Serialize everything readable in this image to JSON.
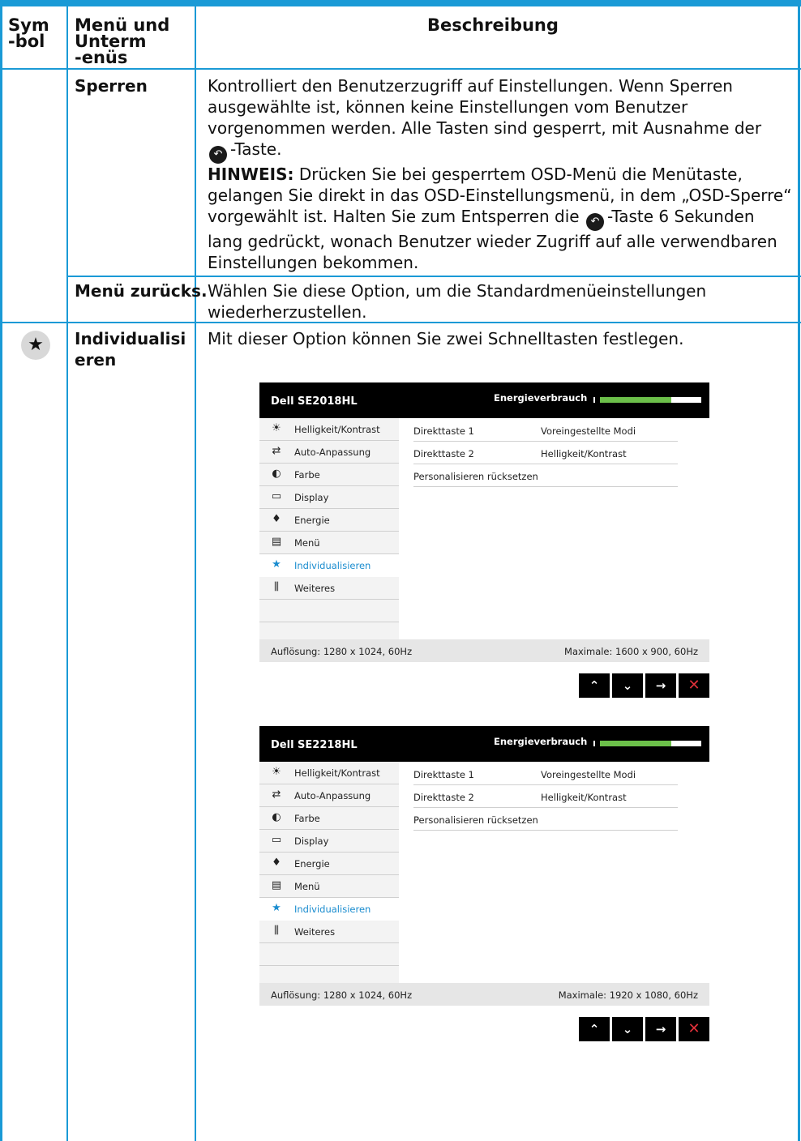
{
  "header": {
    "col1": [
      "Sym",
      "-bol"
    ],
    "col2": [
      "Menü und",
      "Unterm",
      "-enüs"
    ],
    "col3": "Beschreibung"
  },
  "rows": {
    "sperren": {
      "name": "Sperren",
      "line1": "Kontrolliert den Benutzerzugriff auf Einstellungen. Wenn Sperren",
      "line2": "ausgewählte ist, können keine Einstellungen vom Benutzer",
      "line3": "vorgenommen werden. Alle Tasten sind gesperrt, mit Ausnahme der",
      "line4_after": "-Taste.",
      "note_label": "HINWEIS:",
      "note1": " Drücken Sie bei gesperrtem OSD-Menü die Menütaste,",
      "note2": "gelangen Sie direkt in das OSD-Einstellungsmenü, in dem „OSD-Sperre“",
      "note3_before": "vorgewählt ist. Halten Sie zum Entsperren die",
      "note3_after": "-Taste 6 Sekunden",
      "note4": "lang gedrückt, wonach Benutzer wieder Zugriff auf alle verwendbaren",
      "note5": "Einstellungen bekommen.",
      "icon": "back-icon"
    },
    "reset": {
      "name": "Menü zurücks.",
      "line1": "Wählen Sie diese Option, um die Standardmenüeinstellungen",
      "line2": "wiederherzustellen."
    },
    "individual": {
      "symbol": "star-icon",
      "name1": "Individualisi",
      "name2": "eren",
      "line1": "Mit dieser Option können Sie zwei Schnelltasten festlegen."
    }
  },
  "osd1": {
    "model": "Dell SE2018HL",
    "energy_label": "Energieverbrauch",
    "energy_level": 0.7,
    "menu": [
      "Helligkeit/Kontrast",
      "Auto-Anpassung",
      "Farbe",
      "Display",
      "Energie",
      "Menü",
      "Individualisieren",
      "Weiteres"
    ],
    "selected": "Individualisieren",
    "rows": [
      {
        "key": "Direkttaste 1",
        "value": "Voreingestellte Modi"
      },
      {
        "key": "Direkttaste 2",
        "value": "Helligkeit/Kontrast"
      },
      {
        "key": "Personalisieren rücksetzen",
        "value": ""
      }
    ],
    "footer_left": "Auflösung: 1280 x 1024, 60Hz",
    "footer_right": "Maximale: 1600 x 900, 60Hz",
    "buttons": [
      "up-icon",
      "down-icon",
      "enter-icon",
      "close-icon"
    ]
  },
  "osd2": {
    "model": "Dell SE2218HL",
    "energy_label": "Energieverbrauch",
    "energy_level": 0.7,
    "menu": [
      "Helligkeit/Kontrast",
      "Auto-Anpassung",
      "Farbe",
      "Display",
      "Energie",
      "Menü",
      "Individualisieren",
      "Weiteres"
    ],
    "selected": "Individualisieren",
    "rows": [
      {
        "key": "Direkttaste 1",
        "value": "Voreingestellte Modi"
      },
      {
        "key": "Direkttaste 2",
        "value": "Helligkeit/Kontrast"
      },
      {
        "key": "Personalisieren rücksetzen",
        "value": ""
      }
    ],
    "footer_left": "Auflösung: 1280 x 1024, 60Hz",
    "footer_right": "Maximale: 1920 x 1080, 60Hz",
    "buttons": [
      "up-icon",
      "down-icon",
      "enter-icon",
      "close-icon"
    ]
  },
  "colors": {
    "rule": "#1a9ad6",
    "highlight": "#1a8ccf",
    "energy_fill": "#6cc04a",
    "close": "#e0313a"
  }
}
